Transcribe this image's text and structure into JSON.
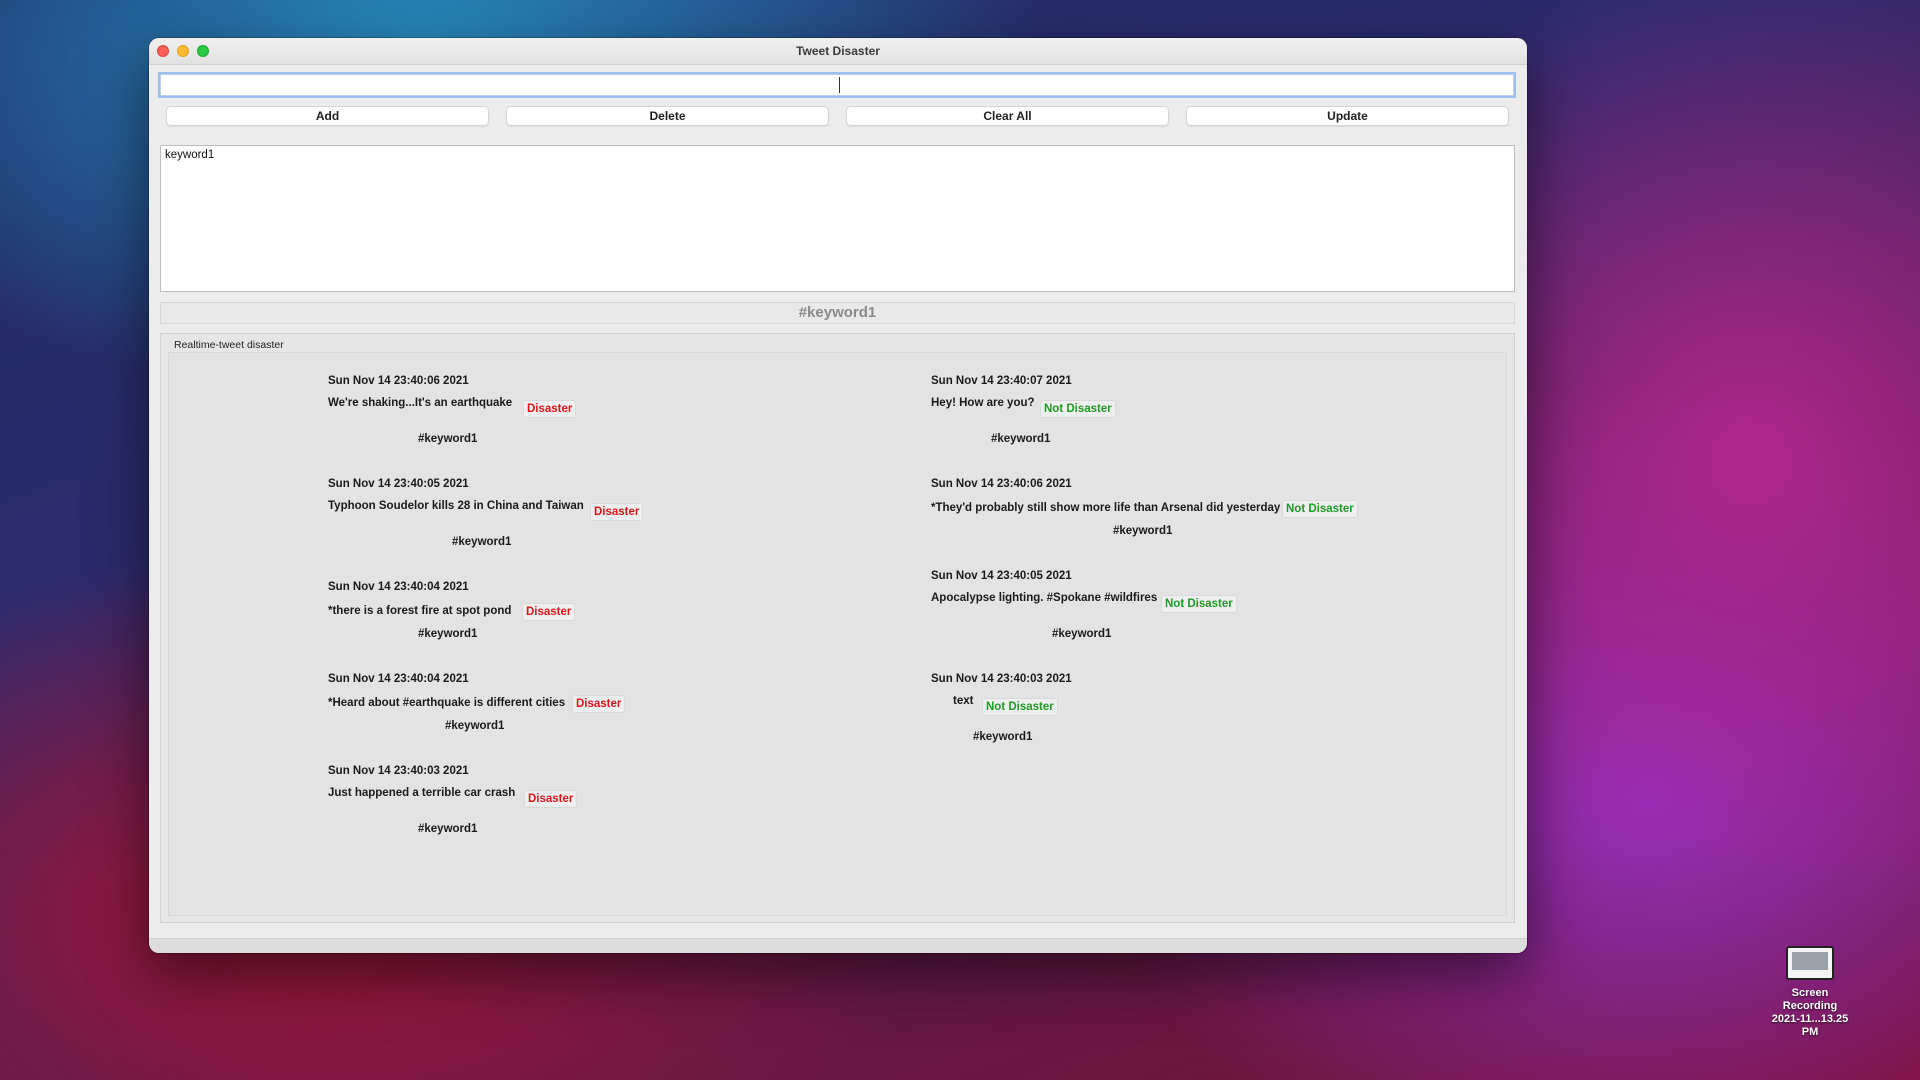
{
  "window": {
    "title": "Tweet Disaster"
  },
  "input": {
    "value": ""
  },
  "buttons": {
    "add": "Add",
    "delete": "Delete",
    "clear_all": "Clear All",
    "update": "Update"
  },
  "keyword_list": [
    "keyword1"
  ],
  "current_keyword": "#keyword1",
  "group_label": "Realtime-tweet disaster",
  "tweets_left": [
    {
      "date": "Sun Nov 14 23:40:06 2021",
      "text": "We're shaking...It's an earthquake",
      "label": "Disaster",
      "tag": "#keyword1"
    },
    {
      "date": "Sun Nov 14 23:40:05 2021",
      "text": "Typhoon Soudelor kills 28 in China and Taiwan",
      "label": "Disaster",
      "tag": "#keyword1"
    },
    {
      "date": "Sun Nov 14 23:40:04 2021",
      "text": "*there is a forest fire at spot pond",
      "label": "Disaster",
      "tag": "#keyword1"
    },
    {
      "date": "Sun Nov 14 23:40:04 2021",
      "text": "*Heard about #earthquake is different cities",
      "label": "Disaster",
      "tag": "#keyword1"
    },
    {
      "date": "Sun Nov 14 23:40:03 2021",
      "text": "Just happened a terrible car crash",
      "label": "Disaster",
      "tag": "#keyword1"
    }
  ],
  "tweets_right": [
    {
      "date": "Sun Nov 14 23:40:07 2021",
      "text": "Hey! How are you?",
      "label": "Not Disaster",
      "tag": "#keyword1"
    },
    {
      "date": "Sun Nov 14 23:40:06 2021",
      "text": "*They'd probably still show more life than Arsenal did yesterday",
      "label": "Not Disaster",
      "tag": "#keyword1"
    },
    {
      "date": "Sun Nov 14 23:40:05 2021",
      "text": "Apocalypse lighting. #Spokane #wildfires",
      "label": "Not Disaster",
      "tag": "#keyword1"
    },
    {
      "date": "Sun Nov 14 23:40:03 2021",
      "text": "text",
      "label": "Not Disaster",
      "tag": "#keyword1"
    }
  ],
  "colors": {
    "disaster": "#e0161b",
    "not_disaster": "#1e9b24"
  },
  "desktop_icon": {
    "name": "screen-recording-file",
    "line1": "Screen Recording",
    "line2": "2021-11...13.25 PM"
  }
}
